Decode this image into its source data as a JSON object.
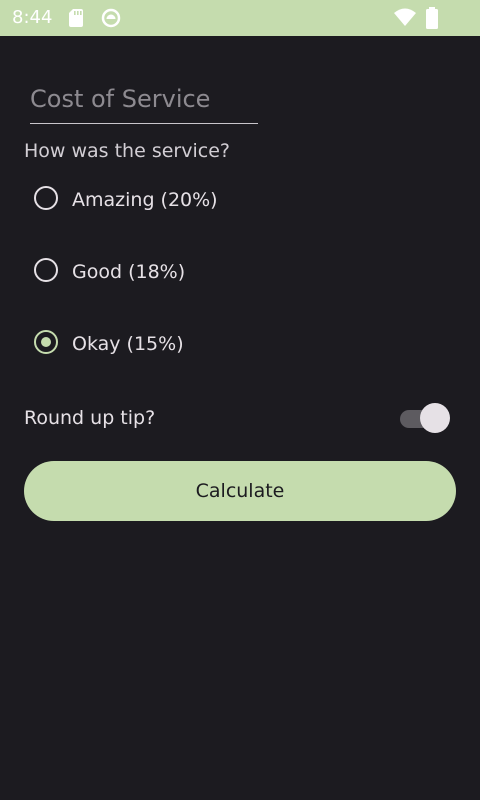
{
  "status_bar": {
    "time": "8:44",
    "icons": [
      "sd-card-icon",
      "circle-notification-icon",
      "wifi-icon",
      "battery-icon"
    ],
    "background": "#c5dcae"
  },
  "form": {
    "cost_input": {
      "placeholder": "Cost of Service",
      "value": ""
    },
    "question": "How was the service?",
    "options": [
      {
        "label": "Amazing (20%)",
        "selected": false
      },
      {
        "label": "Good (18%)",
        "selected": false
      },
      {
        "label": "Okay (15%)",
        "selected": true
      }
    ],
    "round_up": {
      "label": "Round up tip?",
      "on": true
    },
    "calculate_label": "Calculate"
  },
  "colors": {
    "background": "#1c1b20",
    "accent": "#c5dcae",
    "text": "#e6e1e6"
  }
}
